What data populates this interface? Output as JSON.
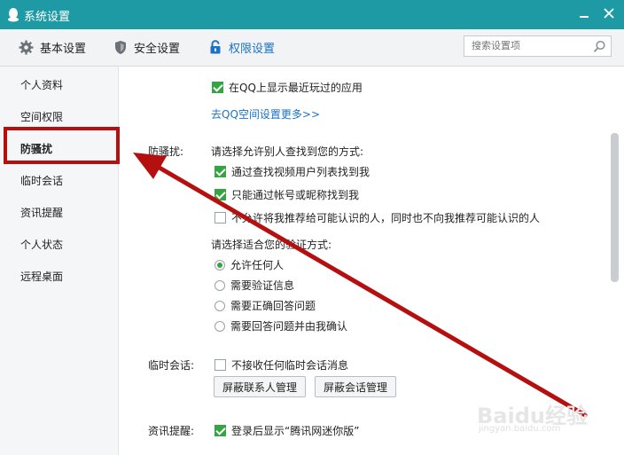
{
  "window": {
    "title": "系统设置"
  },
  "toolbar": {
    "tabs": [
      {
        "label": "基本设置",
        "icon": "gear-icon"
      },
      {
        "label": "安全设置",
        "icon": "shield-icon"
      },
      {
        "label": "权限设置",
        "icon": "lock-icon"
      }
    ],
    "active_tab": "权限设置",
    "search_placeholder": "搜索设置项"
  },
  "sidebar": {
    "items": [
      {
        "label": "个人资料"
      },
      {
        "label": "空间权限"
      },
      {
        "label": "防骚扰"
      },
      {
        "label": "临时会话"
      },
      {
        "label": "资讯提醒"
      },
      {
        "label": "个人状态"
      },
      {
        "label": "远程桌面"
      }
    ],
    "selected": "防骚扰"
  },
  "content": {
    "qq_apps_checkbox": {
      "label": "在QQ上显示最近玩过的应用",
      "checked": true
    },
    "qzone_link": "去QQ空间设置更多>>",
    "anti_harass": {
      "section_label": "防骚扰:",
      "find_prompt": "请选择允许别人查找到您的方式:",
      "find_options": [
        {
          "label": "通过查找视频用户列表找到我",
          "checked": true
        },
        {
          "label": "只能通过帐号或昵称找到我",
          "checked": true
        },
        {
          "label": "不允许将我推荐给可能认识的人，同时也不向我推荐可能认识的人",
          "checked": false
        }
      ],
      "verify_prompt": "请选择适合您的验证方式:",
      "verify_options": [
        {
          "label": "允许任何人",
          "selected": true
        },
        {
          "label": "需要验证信息",
          "selected": false
        },
        {
          "label": "需要正确回答问题",
          "selected": false
        },
        {
          "label": "需要回答问题并由我确认",
          "selected": false
        }
      ]
    },
    "temp_session": {
      "section_label": "临时会话:",
      "checkbox": {
        "label": "不接收任何临时会话消息",
        "checked": false
      },
      "buttons": [
        "屏蔽联系人管理",
        "屏蔽会话管理"
      ]
    },
    "news": {
      "section_label": "资讯提醒:",
      "checkbox": {
        "label": "登录后显示“腾讯网迷你版”",
        "checked": true
      }
    }
  },
  "watermark": {
    "logo_text": "Baidu经验",
    "url": "jingyan.baidu.com"
  },
  "colors": {
    "titlebar": "#1e9aa5",
    "active_tab": "#1a73c6",
    "checkbox_green": "#35a442",
    "annotation_red": "#b50f0f"
  }
}
